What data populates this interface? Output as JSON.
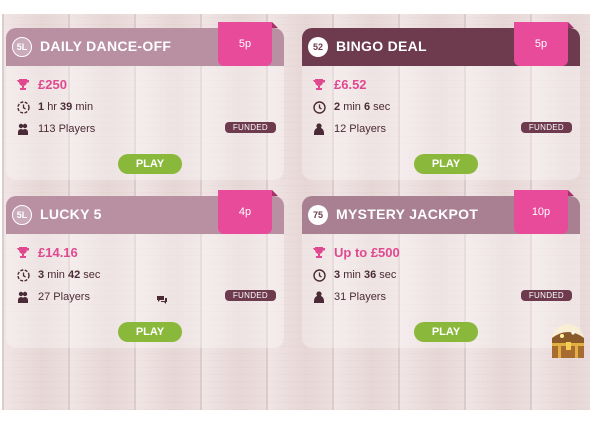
{
  "rooms": [
    {
      "badge": "5L",
      "title": "DAILY DANCE-OFF",
      "price": "5p",
      "prize": "£250",
      "time_a": "1",
      "time_a_unit": "hr",
      "time_b": "39",
      "time_b_unit": "min",
      "players": "113 Players",
      "status": "FUNDED",
      "play": "PLAY"
    },
    {
      "badge": "52",
      "title": "BINGO DEAL",
      "price": "5p",
      "prize": "£6.52",
      "time_a": "2",
      "time_a_unit": "min",
      "time_b": "6",
      "time_b_unit": "sec",
      "players": "12 Players",
      "status": "FUNDED",
      "play": "PLAY"
    },
    {
      "badge": "5L",
      "title": "LUCKY 5",
      "price": "4p",
      "prize": "£14.16",
      "time_a": "3",
      "time_a_unit": "min",
      "time_b": "42",
      "time_b_unit": "sec",
      "players": "27 Players",
      "status": "FUNDED",
      "play": "PLAY"
    },
    {
      "badge": "75",
      "title": "MYSTERY JACKPOT",
      "price": "10p",
      "prize": "Up to £500",
      "time_a": "3",
      "time_a_unit": "min",
      "time_b": "36",
      "time_b_unit": "sec",
      "players": "31 Players",
      "status": "FUNDED",
      "play": "PLAY"
    }
  ],
  "colors": {
    "accent_pink": "#e94b9b",
    "header_light": "#b98fa2",
    "header_dark": "#6e3a4d",
    "play_green": "#8ab83a"
  },
  "icons": {
    "prize": "trophy-icon",
    "time": "clock-icon",
    "players": "players-icon",
    "chat": "chat-icon",
    "treasure": "treasure-chest-icon"
  }
}
